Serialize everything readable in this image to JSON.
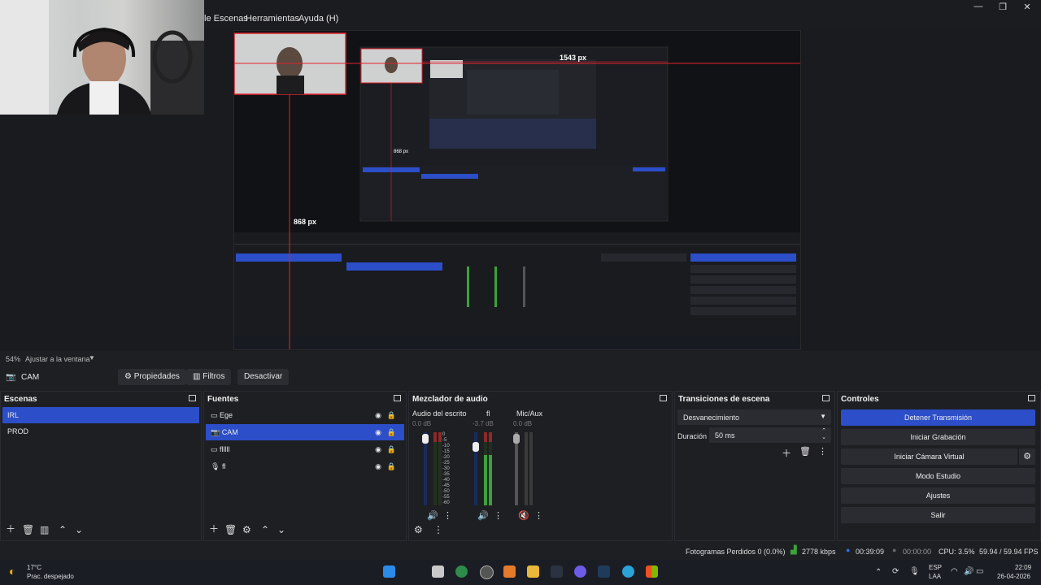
{
  "menu": {
    "items": [
      "le Escenas",
      "Herramientas",
      "Ayuda (H)"
    ]
  },
  "preview": {
    "measure_width": "1543 px",
    "measure_height": "868 px",
    "nested_measure_a": "868 px"
  },
  "zoom": {
    "percent": "54%",
    "fit_label": "Ajustar a la ventana"
  },
  "toolbar": {
    "source_name": "CAM",
    "properties_label": "Propiedades",
    "filters_label": "Filtros",
    "deactivate_label": "Desactivar"
  },
  "scenes": {
    "title": "Escenas",
    "items": [
      "IRL",
      "PROD"
    ]
  },
  "sources": {
    "title": "Fuentes",
    "items": [
      "Ege",
      "CAM",
      "flllll",
      "fl"
    ]
  },
  "mixer": {
    "title": "Mezclador de audio",
    "channels": [
      {
        "name": "Audio del escrito",
        "db": "0.0 dB",
        "level": 0.0
      },
      {
        "name": "fl",
        "db": "-3.7 dB",
        "level": 0.75
      },
      {
        "name": "Mic/Aux",
        "db": "0.0 dB",
        "level": 0.0
      }
    ],
    "scale": [
      "0",
      "-5",
      "-10",
      "-15",
      "-20",
      "-25",
      "-30",
      "-35",
      "-40",
      "-45",
      "-50",
      "-55",
      "-60"
    ]
  },
  "transitions": {
    "title": "Transiciones de escena",
    "selected": "Desvanecimiento",
    "duration_label": "Duración",
    "duration_value": "50 ms"
  },
  "controls": {
    "title": "Controles",
    "buttons": [
      "Detener Transmisión",
      "Iniciar Grabación",
      "Iniciar Cámara Virtual",
      "Modo Estudio",
      "Ajustes",
      "Salir"
    ]
  },
  "status": {
    "dropped_frames": "Fotogramas Perdidos 0 (0.0%)",
    "bitrate": "2778 kbps",
    "stream_time": "00:39:09",
    "rec_time": "00:00:00",
    "cpu": "CPU: 3.5%",
    "fps": "59.94 / 59.94 FPS"
  },
  "taskbar": {
    "weather_temp": "17°C",
    "weather_desc": "Prac. despejado",
    "lang_top": "ESP",
    "lang_bottom": "LAA",
    "time": "22:09",
    "date": "26-04-2026"
  },
  "colors": {
    "accent": "#2c4ec8",
    "background": "#1e1f23",
    "measure_line": "#e0232e"
  }
}
